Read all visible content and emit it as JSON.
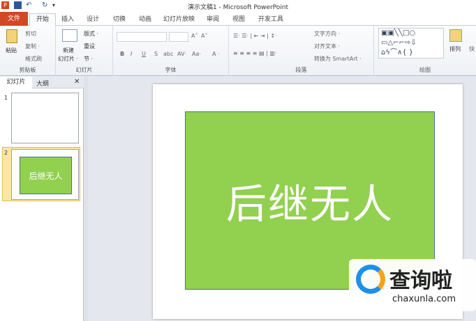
{
  "window": {
    "title": "演示文稿1 - Microsoft PowerPoint",
    "app_icon": "P"
  },
  "tabs": [
    "文件",
    "开始",
    "插入",
    "设计",
    "切换",
    "动画",
    "幻灯片放映",
    "审阅",
    "视图",
    "开发工具"
  ],
  "ribbon": {
    "clipboard": {
      "paste": "粘贴",
      "cut": "剪切",
      "copy": "复制 ·",
      "format_painter": "格式刷",
      "label": "剪贴板"
    },
    "slides": {
      "new_slide": "新建",
      "new_slide2": "幻灯片 ·",
      "layout": "版式 ·",
      "reset": "重设",
      "section": "节 ·",
      "label": "幻灯片"
    },
    "font": {
      "bold": "B",
      "italic": "I",
      "underline": "U",
      "strike": "S",
      "shadow": "abc",
      "spacing": "AV·",
      "case": "Aa·",
      "color": "A ·",
      "grow": "A˄",
      "shrink": "A˅",
      "label": "字体"
    },
    "paragraph": {
      "text_direction": "文字方向 ·",
      "align_text": "对齐文本 ·",
      "smartart": "转换为 SmartArt ·",
      "label": "段落"
    },
    "drawing": {
      "arrange": "排列",
      "quick": "快",
      "label": "绘图"
    }
  },
  "panel": {
    "tab_slides": "幻灯片",
    "tab_outline": "大纲",
    "close": "✕",
    "slides": [
      {
        "num": "1",
        "text": ""
      },
      {
        "num": "2",
        "text": "后继无人"
      }
    ]
  },
  "slide": {
    "text": "后继无人",
    "fill": "#92d050"
  },
  "watermark": {
    "name": "查询啦",
    "url": "chaxunla.com"
  }
}
